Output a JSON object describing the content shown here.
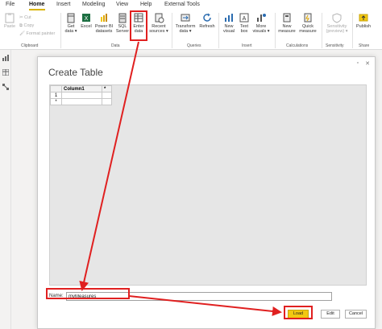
{
  "menu": {
    "tabs": [
      "File",
      "Home",
      "Insert",
      "Modeling",
      "View",
      "Help",
      "External Tools"
    ],
    "active": "Home"
  },
  "ribbon": {
    "clipboard": {
      "paste": "Paste",
      "cut": "Cut",
      "copy": "Copy",
      "format_painter": "Format painter",
      "group": "Clipboard"
    },
    "data": {
      "get_data": [
        "Get",
        "data ▾"
      ],
      "excel": "Excel",
      "pbi": [
        "Power BI",
        "datasets"
      ],
      "sql": [
        "SQL",
        "Server"
      ],
      "enter": [
        "Enter",
        "data"
      ],
      "recent": [
        "Recent",
        "sources ▾"
      ],
      "group": "Data"
    },
    "queries": {
      "transform": [
        "Transform",
        "data ▾"
      ],
      "refresh": "Refresh",
      "group": "Queries"
    },
    "insert": {
      "new_visual": [
        "New",
        "visual"
      ],
      "text_box": [
        "Text",
        "box"
      ],
      "more_visuals": [
        "More",
        "visuals ▾"
      ],
      "group": "Insert"
    },
    "calculations": {
      "new_measure": [
        "New",
        "measure"
      ],
      "quick_measure": [
        "Quick",
        "measure"
      ],
      "group": "Calculations"
    },
    "sensitivity": {
      "label": [
        "Sensitivity",
        "(preview) ▾"
      ],
      "group": "Sensitivity"
    },
    "share": {
      "publish": "Publish",
      "group": "Share"
    }
  },
  "dialog": {
    "title": "Create Table",
    "close": "✕",
    "restore": "▫",
    "table": {
      "column_header": "Column1",
      "col_dropdown": "*",
      "row_numbers": [
        "1",
        "*"
      ]
    },
    "name_label": "Name:",
    "name_value": "myMeasures",
    "buttons": {
      "load": "Load",
      "edit": "Edit",
      "cancel": "Cancel"
    }
  },
  "colors": {
    "accent": "#f2c811",
    "annotation": "#e02020"
  }
}
